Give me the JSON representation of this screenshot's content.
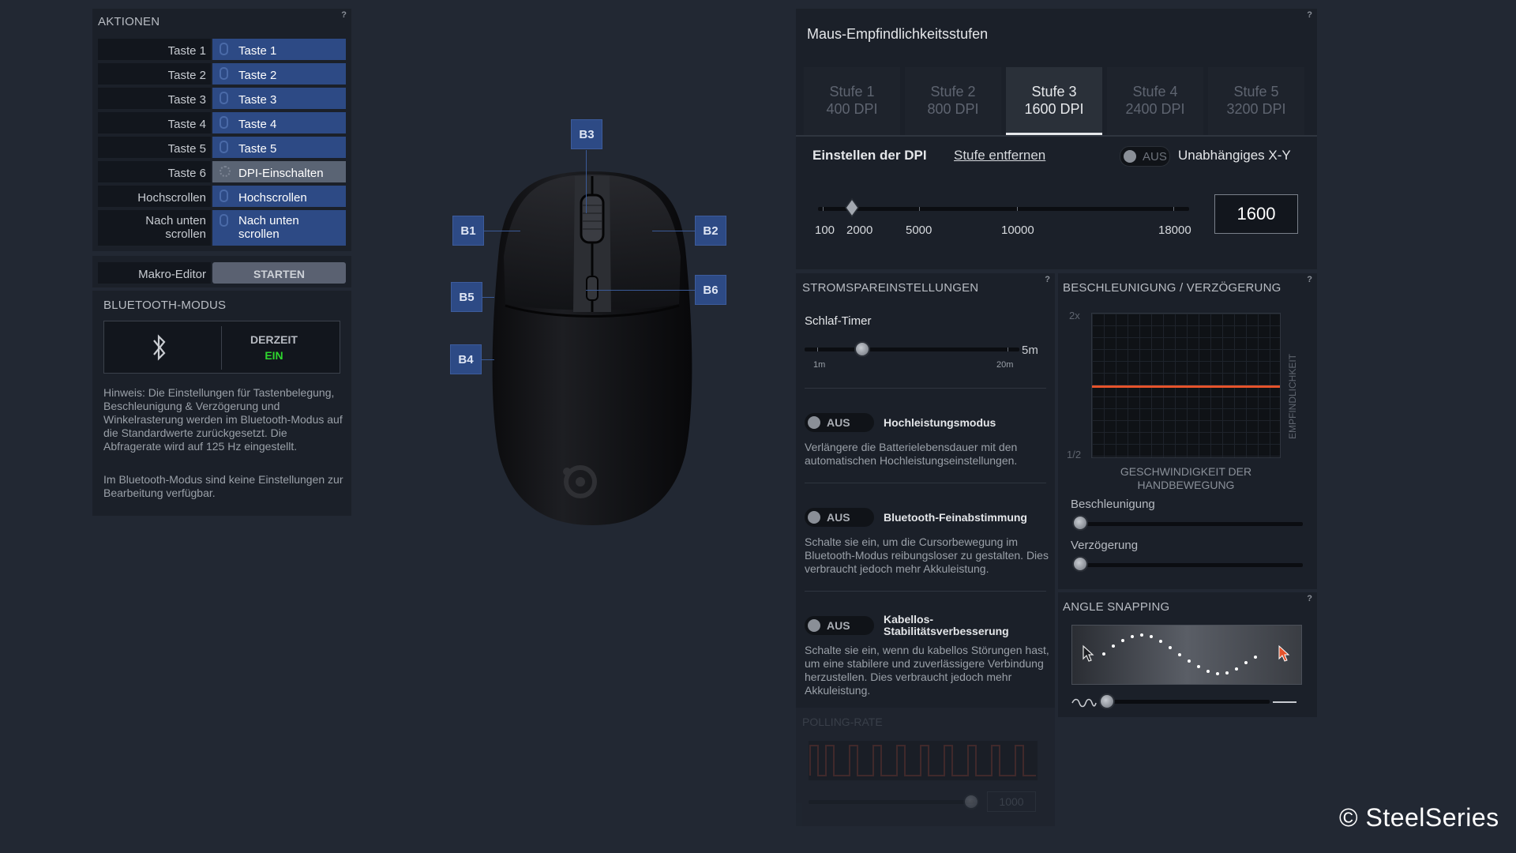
{
  "actions": {
    "title": "AKTIONEN",
    "help": "?",
    "rows": [
      {
        "left": "Taste 1",
        "right": "Taste 1"
      },
      {
        "left": "Taste 2",
        "right": "Taste 2"
      },
      {
        "left": "Taste 3",
        "right": "Taste 3"
      },
      {
        "left": "Taste 4",
        "right": "Taste 4"
      },
      {
        "left": "Taste 5",
        "right": "Taste 5"
      },
      {
        "left": "Taste 6",
        "right": "DPI-Einschalten"
      },
      {
        "left": "Hochscrollen",
        "right": "Hochscrollen"
      },
      {
        "left": "Nach unten scrollen",
        "right": "Nach unten scrollen"
      }
    ],
    "macro_label": "Makro-Editor",
    "macro_button": "STARTEN"
  },
  "bluetooth": {
    "title": "BLUETOOTH-MODUS",
    "status_label": "DERZEIT",
    "status_value": "EIN",
    "hint1": "Hinweis: Die Einstellungen für Tastenbelegung, Beschleunigung & Verzögerung und Winkelrasterung werden im Bluetooth-Modus auf die Standardwerte zurückgesetzt. Die Abfragerate wird auf 125 Hz eingestellt.",
    "hint2": "Im Bluetooth-Modus sind keine Einstellungen zur Bearbeitung verfügbar."
  },
  "mouse_buttons": {
    "b1": "B1",
    "b2": "B2",
    "b3": "B3",
    "b4": "B4",
    "b5": "B5",
    "b6": "B6"
  },
  "dpi": {
    "title": "Maus-Empfindlichkeitsstufen",
    "help": "?",
    "tabs": [
      {
        "l1": "Stufe 1",
        "l2": "400 DPI"
      },
      {
        "l1": "Stufe 2",
        "l2": "800 DPI"
      },
      {
        "l1": "Stufe 3",
        "l2": "1600 DPI"
      },
      {
        "l1": "Stufe 4",
        "l2": "2400 DPI"
      },
      {
        "l1": "Stufe 5",
        "l2": "3200 DPI"
      }
    ],
    "active_tab": 3,
    "set_label": "Einstellen der DPI",
    "remove_link": "Stufe entfernen",
    "toggle_label": "AUS",
    "xy_label": "Unabhängiges X-Y",
    "scale": [
      "100",
      "2000",
      "5000",
      "10000",
      "18000"
    ],
    "value": "1600"
  },
  "power": {
    "title": "STROMSPAREINSTELLUNGEN",
    "help": "?",
    "sleep_label": "Schlaf-Timer",
    "sleep_value": "5m",
    "sleep_min": "1m",
    "sleep_max": "20m",
    "features": [
      {
        "toggle": "AUS",
        "name": "Hochleistungsmodus",
        "desc": "Verlängere die Batterielebensdauer mit den automatischen Hochleistungseinstellungen."
      },
      {
        "toggle": "AUS",
        "name": "Bluetooth-Feinabstimmung",
        "desc": "Schalte sie ein, um die Cursorbewegung im Bluetooth-Modus reibungsloser zu gestalten. Dies verbraucht jedoch mehr Akkuleistung."
      },
      {
        "toggle": "AUS",
        "name": "Kabellos-Stabilitätsverbesserung",
        "desc": "Schalte sie ein, wenn du kabellos Störungen hast, um eine stabilere und zuverlässigere Verbindung herzustellen. Dies verbraucht jedoch mehr Akkuleistung."
      }
    ]
  },
  "polling": {
    "title": "POLLING-RATE",
    "value": "1000"
  },
  "accel": {
    "title": "BESCHLEUNIGUNG / VERZÖGERUNG",
    "help": "?",
    "y_top": "2x",
    "y_bottom": "1/2",
    "y_axis": "EMPFINDLICHKEIT",
    "x_axis": "GESCHWINDIGKEIT DER HANDBEWEGUNG",
    "accel_label": "Beschleunigung",
    "decel_label": "Verzögerung"
  },
  "angle": {
    "title": "ANGLE SNAPPING",
    "help": "?"
  },
  "watermark": "© SteelSeries",
  "colors": {
    "accent": "#2d4a85",
    "curve": "#e5532b",
    "status_on": "#2ed62e"
  }
}
